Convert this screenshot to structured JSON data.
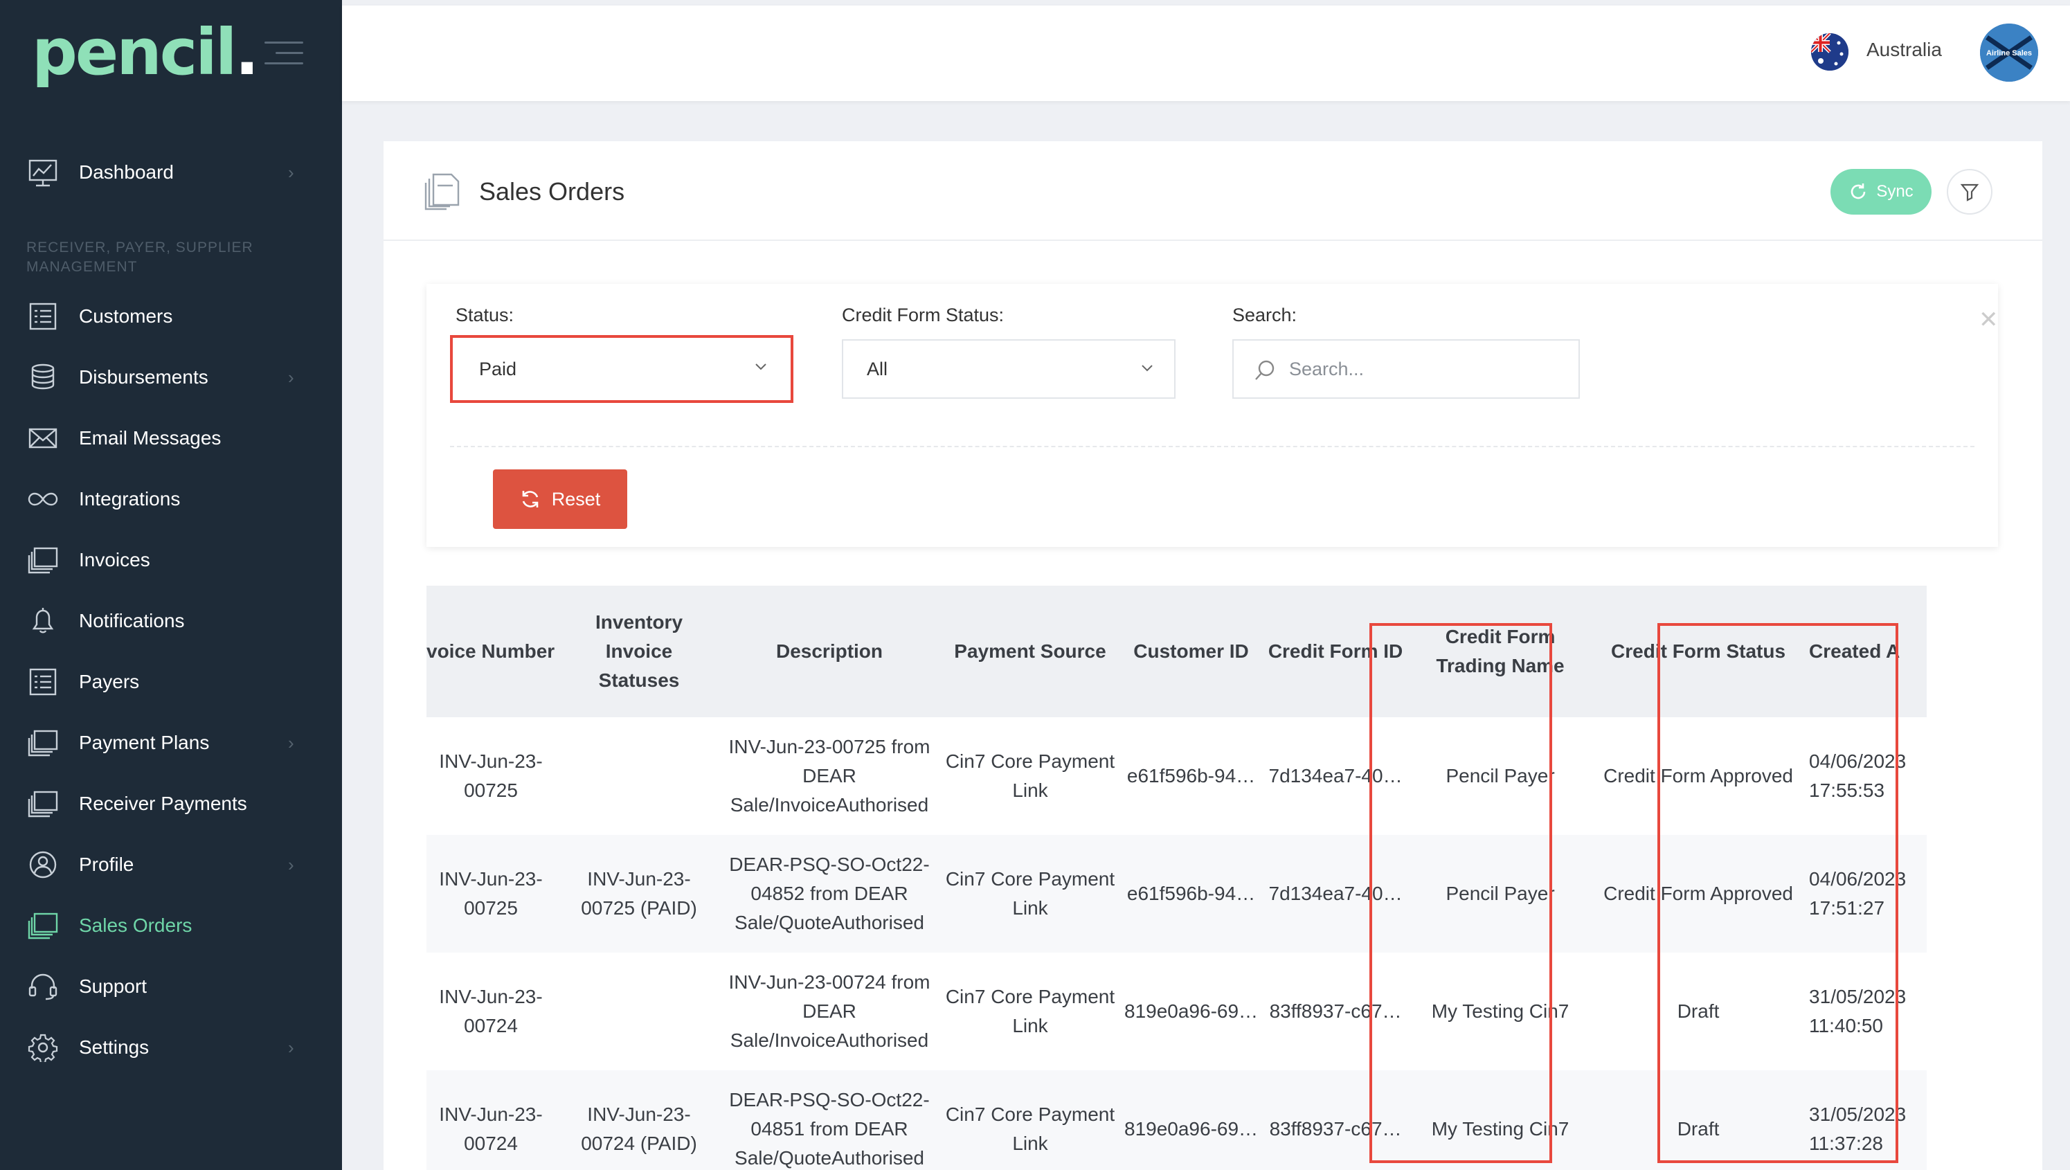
{
  "app": {
    "logo_text": "pencil",
    "logo_dot": "."
  },
  "sidebar": {
    "section_header": "RECEIVER, PAYER, SUPPLIER MANAGEMENT",
    "items": [
      {
        "label": "Dashboard",
        "icon": "dashboard-icon",
        "has_submenu": true
      },
      {
        "label": "Customers",
        "icon": "list-icon",
        "has_submenu": false
      },
      {
        "label": "Disbursements",
        "icon": "coins-icon",
        "has_submenu": true
      },
      {
        "label": "Email Messages",
        "icon": "envelope-icon",
        "has_submenu": false
      },
      {
        "label": "Integrations",
        "icon": "infinity-icon",
        "has_submenu": false
      },
      {
        "label": "Invoices",
        "icon": "stacked-docs-icon",
        "has_submenu": false
      },
      {
        "label": "Notifications",
        "icon": "bell-icon",
        "has_submenu": false
      },
      {
        "label": "Payers",
        "icon": "list-icon",
        "has_submenu": false
      },
      {
        "label": "Payment Plans",
        "icon": "stacked-docs-icon",
        "has_submenu": true
      },
      {
        "label": "Receiver Payments",
        "icon": "stacked-docs-icon",
        "has_submenu": false
      },
      {
        "label": "Profile",
        "icon": "profile-icon",
        "has_submenu": true
      },
      {
        "label": "Sales Orders",
        "icon": "stacked-docs-icon",
        "has_submenu": false,
        "active": true
      },
      {
        "label": "Support",
        "icon": "headset-icon",
        "has_submenu": false
      },
      {
        "label": "Settings",
        "icon": "gear-icon",
        "has_submenu": true
      }
    ]
  },
  "topbar": {
    "region": "Australia",
    "avatar_text": "Airline Sales"
  },
  "page": {
    "title": "Sales Orders",
    "sync_label": "Sync"
  },
  "filters": {
    "status_label": "Status:",
    "status_value": "Paid",
    "credit_form_status_label": "Credit Form Status:",
    "credit_form_status_value": "All",
    "search_label": "Search:",
    "search_placeholder": "Search...",
    "reset_label": "Reset"
  },
  "table": {
    "headers": {
      "invoice_number": "voice Number",
      "inventory_invoice_statuses": "Inventory Invoice Statuses",
      "description": "Description",
      "payment_source": "Payment Source",
      "customer_id": "Customer ID",
      "credit_form_id": "Credit Form ID",
      "credit_form_trading_name": "Credit Form Trading Name",
      "credit_form_status": "Credit Form Status",
      "created_at": "Created A"
    },
    "rows": [
      {
        "invoice_number": "INV-Jun-23-00725",
        "inventory_invoice_statuses": "",
        "description": "INV-Jun-23-00725 from DEAR Sale/InvoiceAuthorised",
        "payment_source": "Cin7 Core Payment Link",
        "customer_id": "e61f596b-94…",
        "credit_form_id": "7d134ea7-40…",
        "credit_form_trading_name": "Pencil Payer",
        "credit_form_status": "Credit Form Approved",
        "created_at": "04/06/2023 17:55:53"
      },
      {
        "invoice_number": "INV-Jun-23-00725",
        "inventory_invoice_statuses": "INV-Jun-23-00725 (PAID)",
        "description": "DEAR-PSQ-SO-Oct22-04852 from DEAR Sale/QuoteAuthorised",
        "payment_source": "Cin7 Core Payment Link",
        "customer_id": "e61f596b-94…",
        "credit_form_id": "7d134ea7-40…",
        "credit_form_trading_name": "Pencil Payer",
        "credit_form_status": "Credit Form Approved",
        "created_at": "04/06/2023 17:51:27"
      },
      {
        "invoice_number": "INV-Jun-23-00724",
        "inventory_invoice_statuses": "",
        "description": "INV-Jun-23-00724 from DEAR Sale/InvoiceAuthorised",
        "payment_source": "Cin7 Core Payment Link",
        "customer_id": "819e0a96-69…",
        "credit_form_id": "83ff8937-c67…",
        "credit_form_trading_name": "My Testing Cin7",
        "credit_form_status": "Draft",
        "created_at": "31/05/2023 11:40:50"
      },
      {
        "invoice_number": "INV-Jun-23-00724",
        "inventory_invoice_statuses": "INV-Jun-23-00724 (PAID)",
        "description": "DEAR-PSQ-SO-Oct22-04851 from DEAR Sale/QuoteAuthorised",
        "payment_source": "Cin7 Core Payment Link",
        "customer_id": "819e0a96-69…",
        "credit_form_id": "83ff8937-c67…",
        "credit_form_trading_name": "My Testing Cin7",
        "credit_form_status": "Draft",
        "created_at": "31/05/2023 11:37:28"
      }
    ]
  },
  "colors": {
    "sidebar_bg": "#1e2b38",
    "accent_green": "#6fd6a8",
    "reset_red": "#dd5340",
    "highlight_red": "#e8483d"
  }
}
